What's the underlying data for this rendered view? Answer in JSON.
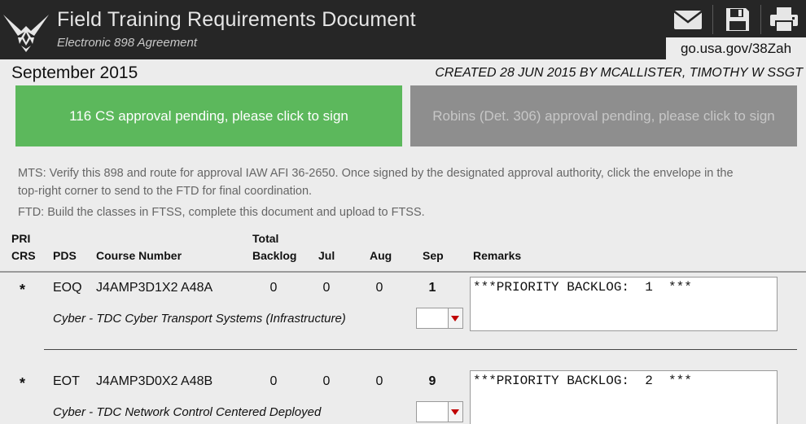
{
  "header": {
    "title": "Field Training Requirements Document",
    "subtitle": "Electronic 898 Agreement",
    "shortlink": "go.usa.gov/38Zah"
  },
  "toolbar": {
    "icons": [
      "mail-icon",
      "save-icon",
      "print-icon"
    ]
  },
  "period": "September 2015",
  "created": "CREATED 28 JUN 2015 BY MCALLISTER, TIMOTHY W SSGT",
  "approvals": {
    "cs": "116 CS approval pending, please click to sign",
    "robins": "Robins (Det. 306) approval pending, please click to sign"
  },
  "instructions": {
    "mts": "MTS: Verify this 898 and route for approval IAW AFI 36-2650.  Once signed by the designated approval authority, click the envelope in the top-right corner to send to the FTD for final coordination.",
    "ftd": "FTD:  Build the classes in FTSS, complete this document and upload to FTSS."
  },
  "columns": {
    "pri_line1": "PRI",
    "pri_line2": "CRS",
    "pds": "PDS",
    "course": "Course Number",
    "total_line1": "Total",
    "total_line2": "Backlog",
    "jul": "Jul",
    "aug": "Aug",
    "sep": "Sep",
    "remarks": "Remarks"
  },
  "rows": [
    {
      "pri": "*",
      "pds": "EOQ",
      "course": "J4AMP3D1X2 A48A",
      "backlog": "0",
      "jul": "0",
      "aug": "0",
      "sep": "1",
      "description": "Cyber - TDC Cyber Transport Systems (Infrastructure)",
      "remarks": "***PRIORITY BACKLOG:  1  ***"
    },
    {
      "pri": "*",
      "pds": "EOT",
      "course": "J4AMP3D0X2 A48B",
      "backlog": "0",
      "jul": "0",
      "aug": "0",
      "sep": "9",
      "description": "Cyber - TDC Network Control Centered Deployed",
      "remarks": "***PRIORITY BACKLOG:  2  ***"
    }
  ],
  "colors": {
    "header_bg": "#262626",
    "approve_green": "#5cb85c",
    "pending_gray": "#8e8e8e",
    "dropdown_arrow": "#c00000"
  }
}
